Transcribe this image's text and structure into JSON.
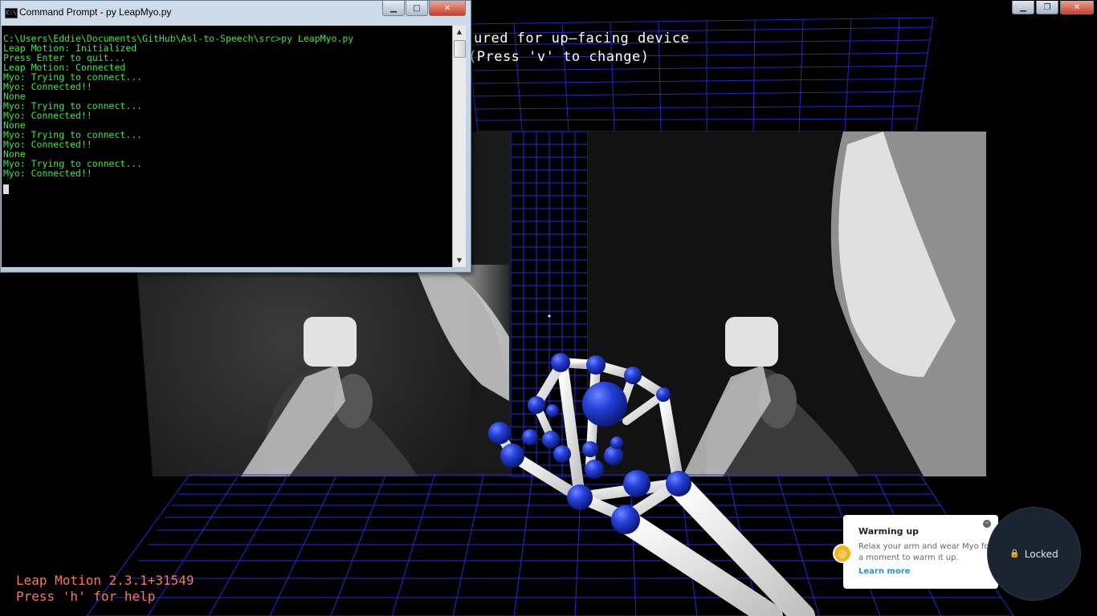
{
  "visualizer": {
    "orientation_line1": "ured for up—facing device",
    "orientation_line2": "(Press 'v' to change)",
    "version": "Leap Motion 2.3.1+31549",
    "help_hint": "Press 'h' for help",
    "controls": {
      "minimize": "▁",
      "maximize": "❐",
      "close": "✕"
    }
  },
  "cmd": {
    "title": "Command Prompt - py  LeapMyo.py",
    "icon_label": "C:\\",
    "controls": {
      "minimize": "▁",
      "maximize": "□",
      "close": "✕"
    },
    "lines": [
      "C:\\Users\\Eddie\\Documents\\GitHub\\Asl-to-Speech\\src>py LeapMyo.py",
      "Leap Motion: Initialized",
      "Press Enter to quit...",
      "Leap Motion: Connected",
      "Myo: Trying to connect...",
      "Myo: Connected!!",
      "None",
      "Myo: Trying to connect...",
      "Myo: Connected!!",
      "None",
      "Myo: Trying to connect...",
      "Myo: Connected!!",
      "None",
      "Myo: Trying to connect...",
      "Myo: Connected!!"
    ]
  },
  "myo": {
    "title": "Warming up",
    "message": "Relax your arm and wear Myo for a moment to warm it up.",
    "link": "Learn more",
    "lock_status": "Locked",
    "accent": "#f6b21b",
    "link_color": "#2e8ed6"
  },
  "colors": {
    "grid": "#1f2fd0",
    "joint": "#1b35c9",
    "bone": "#e8e8e8",
    "console_text": "#3ee83e",
    "version_text": "#f47a5a"
  }
}
